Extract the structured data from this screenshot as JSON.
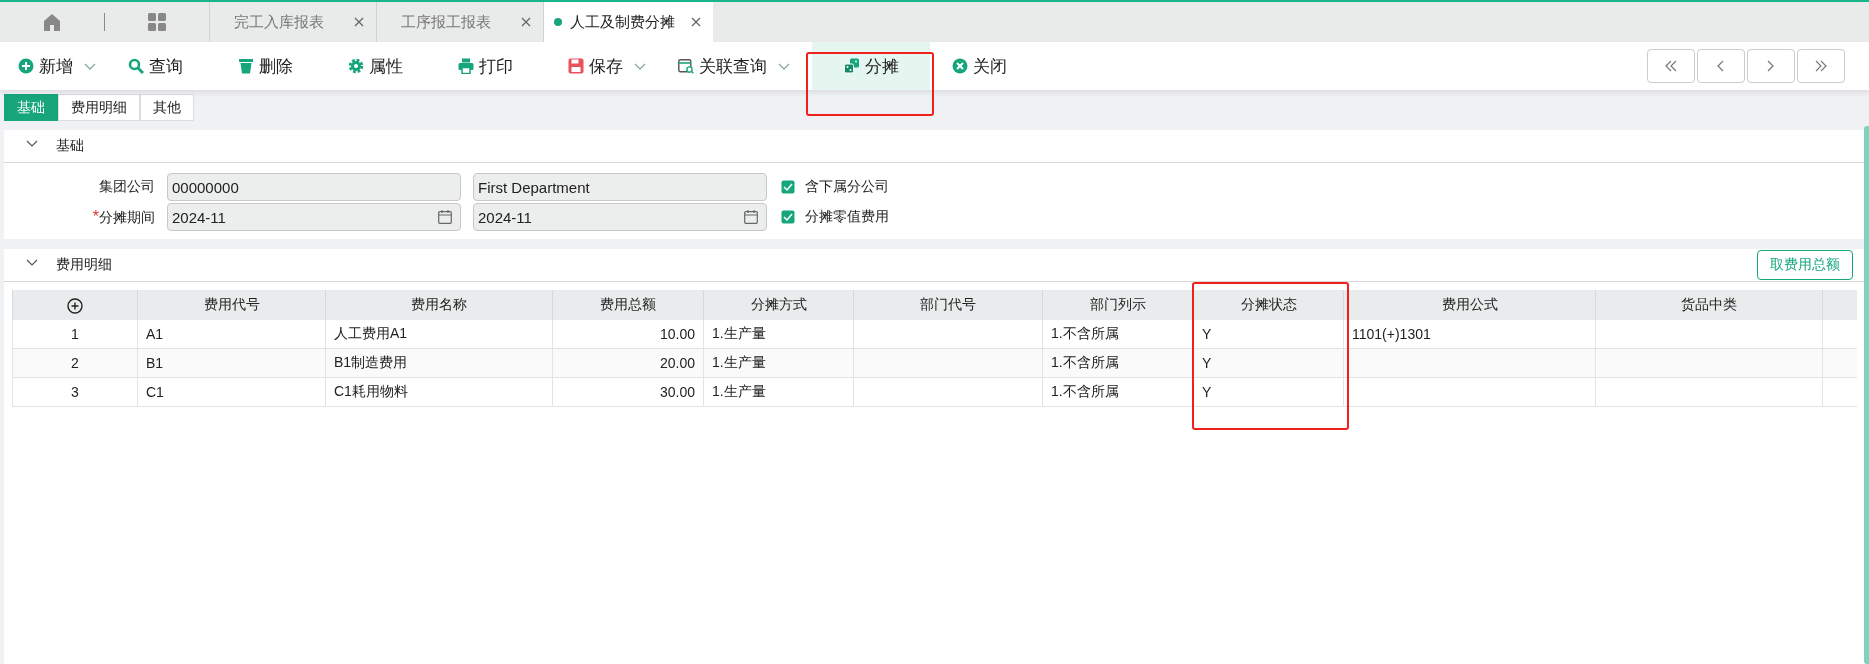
{
  "tabs": [
    {
      "label": "完工入库报表",
      "selected": false
    },
    {
      "label": "工序报工报表",
      "selected": false
    },
    {
      "label": "人工及制费分摊",
      "selected": true
    }
  ],
  "toolbar": [
    {
      "label": "新增",
      "dropdown": true,
      "highlighted": false
    },
    {
      "label": "查询",
      "dropdown": false,
      "highlighted": false
    },
    {
      "label": "删除",
      "dropdown": false,
      "highlighted": false
    },
    {
      "label": "属性",
      "dropdown": false,
      "highlighted": false
    },
    {
      "label": "打印",
      "dropdown": false,
      "highlighted": false
    },
    {
      "label": "保存",
      "dropdown": true,
      "highlighted": false
    },
    {
      "label": "关联查询",
      "dropdown": true,
      "highlighted": false
    },
    {
      "label": "分摊",
      "dropdown": false,
      "highlighted": true
    },
    {
      "label": "关闭",
      "dropdown": false,
      "highlighted": false
    }
  ],
  "subtabs": [
    {
      "label": "基础",
      "selected": true
    },
    {
      "label": "费用明细",
      "selected": false
    },
    {
      "label": "其他",
      "selected": false
    }
  ],
  "basic_section": {
    "title": "基础",
    "expanded": true,
    "fields": [
      {
        "label": "集团公司",
        "kind": "text",
        "values": [
          "00000000",
          "First Department"
        ]
      },
      {
        "label": "分摊期间",
        "required_mark": "*",
        "kind": "date",
        "values": [
          "2024-11",
          "2024-11"
        ]
      }
    ],
    "checkboxes": [
      {
        "label": "含下属分公司",
        "checked": true
      },
      {
        "label": "分摊零值费用",
        "checked": true
      }
    ]
  },
  "detail_section": {
    "title": "费用明细",
    "expanded": true,
    "action": "取费用总额",
    "table": {
      "columns": [
        {
          "kind": "add",
          "highlighted": false
        },
        {
          "label": "费用代号",
          "kind": "text",
          "highlighted": false
        },
        {
          "label": "费用名称",
          "kind": "text",
          "highlighted": false
        },
        {
          "label": "费用总额",
          "kind": "number",
          "highlighted": false
        },
        {
          "label": "分摊方式",
          "kind": "text",
          "highlighted": false
        },
        {
          "label": "部门代号",
          "kind": "text",
          "highlighted": false
        },
        {
          "label": "部门列示",
          "kind": "text",
          "highlighted": false
        },
        {
          "label": "分摊状态",
          "kind": "text",
          "highlighted": true
        },
        {
          "label": "费用公式",
          "kind": "text",
          "highlighted": false
        },
        {
          "label": "货品中类",
          "kind": "text",
          "highlighted": false
        }
      ],
      "rows": [
        [
          "1",
          "A1",
          "人工费用A1",
          "10.00",
          "1.生产量",
          "",
          "1.不含所属",
          "Y",
          "1101(+)1301",
          ""
        ],
        [
          "2",
          "B1",
          "B1制造费用",
          "20.00",
          "1.生产量",
          "",
          "1.不含所属",
          "Y",
          "",
          ""
        ],
        [
          "3",
          "C1",
          "C1耗用物料",
          "30.00",
          "1.生产量",
          "",
          "1.不含所属",
          "Y",
          "",
          ""
        ]
      ]
    }
  }
}
